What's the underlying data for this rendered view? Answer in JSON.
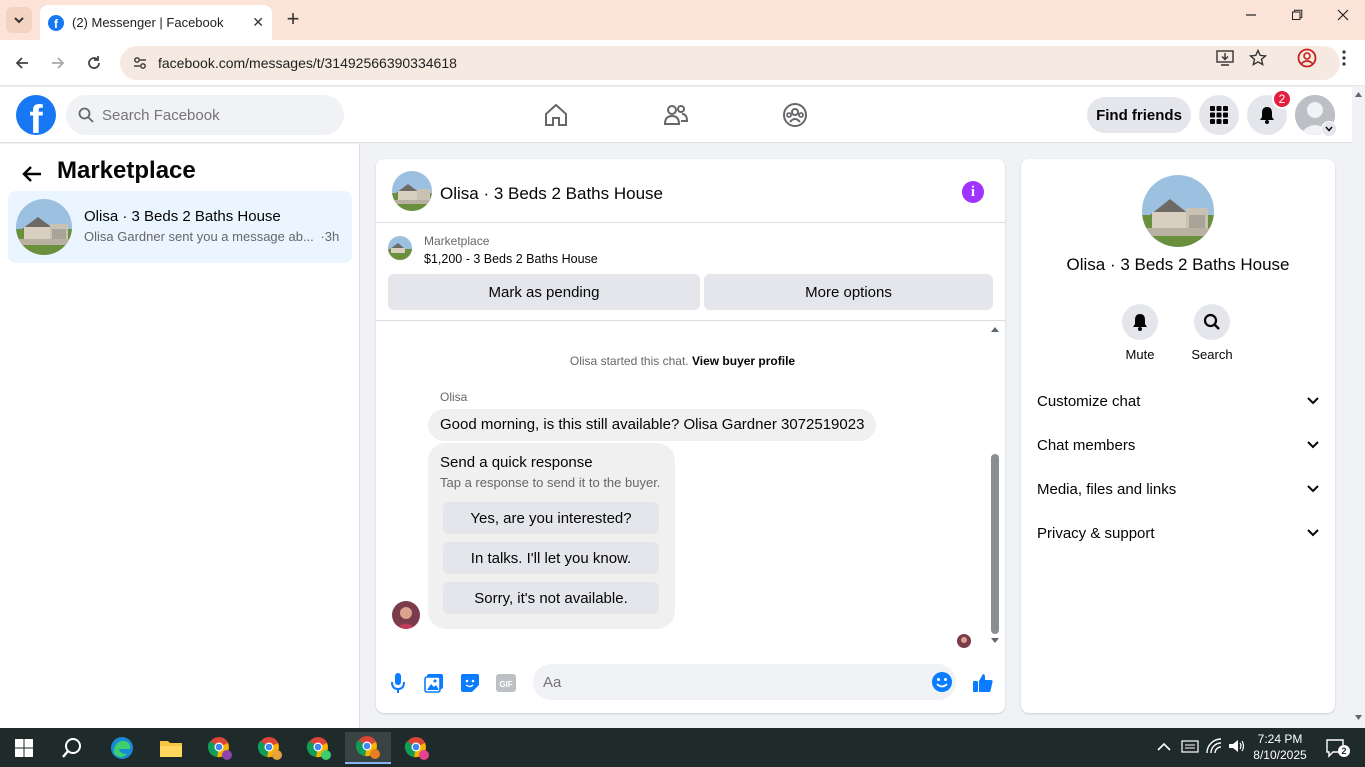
{
  "browser": {
    "tab_title": "(2) Messenger | Facebook",
    "url": "facebook.com/messages/t/31492566390334618",
    "new_tab": "+",
    "tab_close": "✕"
  },
  "fb": {
    "search_placeholder": "Search Facebook",
    "find_friends": "Find friends",
    "notif_count": "2",
    "brand_color": "#1877f2"
  },
  "left": {
    "title": "Marketplace",
    "item": {
      "title": "Olisa · 3 Beds 2 Baths House",
      "preview": "Olisa Gardner sent you a message ab...",
      "time": "·3h"
    }
  },
  "chat": {
    "header_name": "Olisa · 3 Beds 2 Baths House",
    "listing_source": "Marketplace",
    "listing_title": "$1,200 - 3 Beds 2 Baths House",
    "mark_pending": "Mark as pending",
    "more_options": "More options",
    "system_msg": "Olisa started this chat.",
    "view_profile": "View buyer profile",
    "sender": "Olisa",
    "message": "Good morning, is this still available? Olisa Gardner 3072519023",
    "quick_title": "Send a quick response",
    "quick_sub": "Tap a response to send it to the buyer.",
    "quick_responses": [
      "Yes, are you interested?",
      "In talks. I'll let you know.",
      "Sorry, it's not available."
    ],
    "composer_placeholder": "Aa"
  },
  "right": {
    "name": "Olisa · 3 Beds 2 Baths House",
    "mute": "Mute",
    "search": "Search",
    "sections": [
      "Customize chat",
      "Chat members",
      "Media, files and links",
      "Privacy & support"
    ]
  },
  "taskbar": {
    "time": "7:24 PM",
    "date": "8/10/2025",
    "notif_count": "2"
  }
}
